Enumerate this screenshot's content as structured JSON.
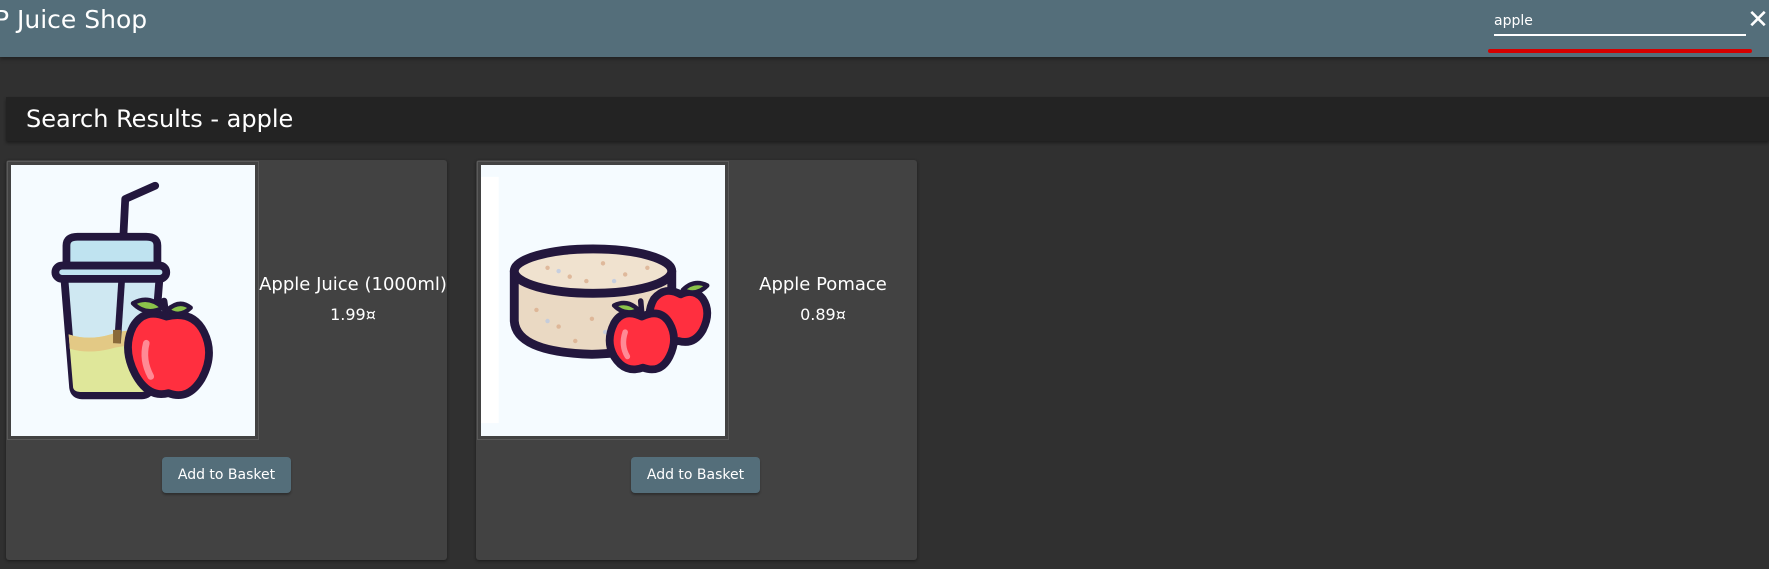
{
  "header": {
    "app_title": "P Juice Shop",
    "search": {
      "value": "apple",
      "close_icon": "✕"
    }
  },
  "results": {
    "title": "Search Results - apple"
  },
  "products": [
    {
      "name": "Apple Juice (1000ml)",
      "price": "1.99¤",
      "image_icon": "apple-juice-image",
      "button_label": "Add to Basket"
    },
    {
      "name": "Apple Pomace",
      "price": "0.89¤",
      "image_icon": "apple-pomace-image",
      "button_label": "Add to Basket"
    }
  ],
  "colors": {
    "toolbar": "#546e7a",
    "background": "#303030",
    "card": "#424242",
    "search_highlight": "#d50000"
  }
}
